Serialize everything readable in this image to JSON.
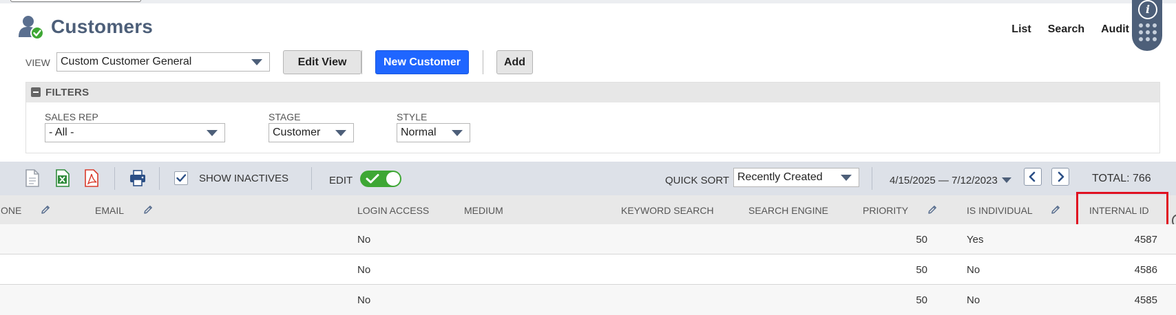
{
  "header": {
    "title": "Customers",
    "links": [
      "List",
      "Search",
      "Audit"
    ]
  },
  "view": {
    "label": "VIEW",
    "selected": "Custom Customer General",
    "edit_view_label": "Edit View",
    "new_customer_label": "New Customer",
    "add_label": "Add"
  },
  "filters": {
    "title": "FILTERS",
    "sales_rep": {
      "label": "SALES REP",
      "value": "- All -"
    },
    "stage": {
      "label": "STAGE",
      "value": "Customer"
    },
    "style": {
      "label": "STYLE",
      "value": "Normal"
    }
  },
  "toolbar": {
    "show_inactives_label": "SHOW INACTIVES",
    "show_inactives_checked": true,
    "edit_label": "EDIT",
    "edit_on": true,
    "quick_sort_label": "QUICK SORT",
    "quick_sort_value": "Recently Created",
    "date_range": "4/15/2025 — 7/12/2023",
    "total": "TOTAL: 766"
  },
  "table": {
    "columns": {
      "phone": "ONE",
      "email": "EMAIL",
      "login_access": "LOGIN ACCESS",
      "medium": "MEDIUM",
      "keyword_search": "KEYWORD SEARCH",
      "search_engine": "SEARCH ENGINE",
      "priority": "PRIORITY",
      "is_individual": "IS INDIVIDUAL",
      "internal_id": "INTERNAL ID"
    },
    "rows": [
      {
        "login_access": "No",
        "priority": "50",
        "is_individual": "Yes",
        "internal_id": "4587"
      },
      {
        "login_access": "No",
        "priority": "50",
        "is_individual": "No",
        "internal_id": "4586"
      },
      {
        "login_access": "No",
        "priority": "50",
        "is_individual": "No",
        "internal_id": "4585"
      }
    ]
  },
  "colors": {
    "title": "#4d5f79",
    "primary_button": "#1f66ff",
    "toggle_on": "#3ea734",
    "highlight": "#e01020",
    "toolbar_bg": "#dde1e8"
  }
}
